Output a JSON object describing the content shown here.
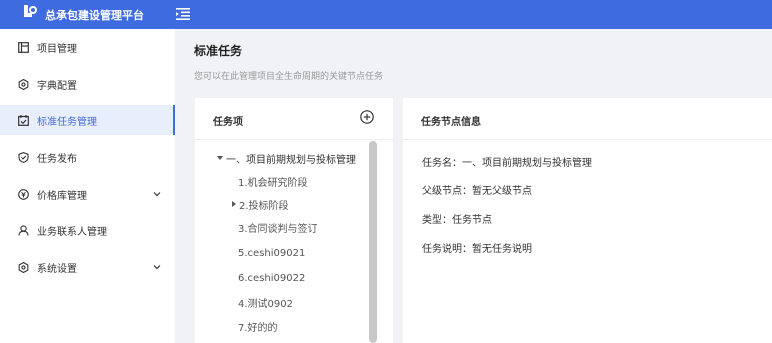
{
  "header": {
    "app_title": "总承包建设管理平台"
  },
  "sidebar": {
    "items": [
      {
        "label": "项目管理"
      },
      {
        "label": "字典配置"
      },
      {
        "label": "标准任务管理"
      },
      {
        "label": "任务发布"
      },
      {
        "label": "价格库管理"
      },
      {
        "label": "业务联系人管理"
      },
      {
        "label": "系统设置"
      }
    ],
    "active_index": 2
  },
  "page": {
    "title": "标准任务",
    "subtitle": "您可以在此管理项目全生命周期的关键节点任务"
  },
  "task_panel": {
    "title": "任务项",
    "tree": {
      "root": "一、项目前期规划与投标管理",
      "children": [
        {
          "label": "1.机会研究阶段",
          "expandable": false
        },
        {
          "label": "2.投标阶段",
          "expandable": true
        },
        {
          "label": "3.合同谈判与签订",
          "expandable": false
        },
        {
          "label": "5.ceshi09021",
          "expandable": false
        },
        {
          "label": "6.ceshi09022",
          "expandable": false
        },
        {
          "label": "4.测试0902",
          "expandable": false
        },
        {
          "label": "7.好的的",
          "expandable": false
        }
      ]
    }
  },
  "info_panel": {
    "title": "任务节点信息",
    "lines": [
      "任务名：一、项目前期规划与投标管理",
      "父级节点：暂无父级节点",
      "类型：任务节点",
      "任务说明：暂无任务说明"
    ]
  },
  "colors": {
    "primary": "#3f6be0",
    "active_bg": "#e8eefb"
  },
  "icons": {
    "logo": "app-logo",
    "menu_toggle": "menu-fold-icon",
    "add": "plus-circle-icon"
  }
}
